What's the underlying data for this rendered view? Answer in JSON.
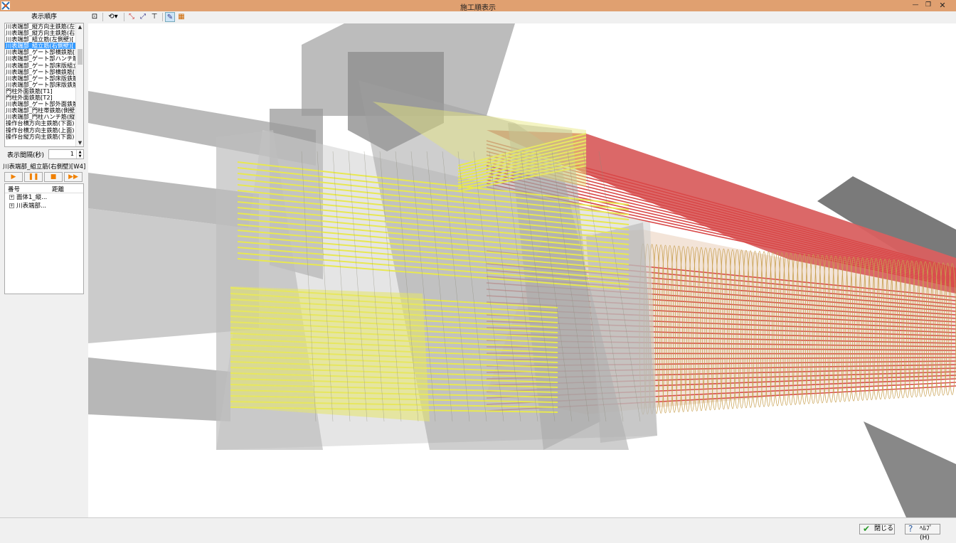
{
  "window": {
    "title": "施工順表示"
  },
  "sequence_panel": {
    "header": "表示順序",
    "items": [
      "川表端部_縦方向主鉄筋(左",
      "川表端部_縦方向主鉄筋(右",
      "川表端部_組立筋(左側壁)[",
      "川表端部_組立筋(右側壁)[",
      "川表端部_ゲート部横鉄筋[",
      "川表端部_ゲート部ハンチ筋",
      "川表端部_ゲート部床版組立",
      "川表端部_ゲート部横鉄筋[",
      "川表端部_ゲート部床版鉄筋",
      "川表端部_ゲート部床版鉄筋",
      "門柱外面鉄筋[T1]",
      "門柱外面鉄筋[T2]",
      "川表端部_ゲート部外面鉄筋",
      "川表端部_門柱帯鉄筋(側壁",
      "川表端部_門柱ハンチ筋(縦",
      "操作台横方向主鉄筋(下面)",
      "操作台横方向主鉄筋(上面)",
      "操作台縦方向主鉄筋(下面)"
    ],
    "selected_index": 3
  },
  "interval": {
    "label": "表示間隔(秒)",
    "value": "1"
  },
  "current_step_label": "川表端部_組立筋(右側壁)[W4]",
  "tree": {
    "col_number": "番号",
    "col_distance": "距離",
    "rows": [
      "面体1_縦...",
      "川表端部..."
    ]
  },
  "buttons": {
    "close": "閉じる",
    "help": "ﾍﾙﾌﾟ(H)"
  },
  "colors": {
    "titlebar": "#e0a070",
    "rebar_red": "#e05050",
    "rebar_yellow": "#e8e850",
    "concrete": "#9a9a9a",
    "selection": "#3399ff"
  },
  "icons": [
    "app-icon",
    "fit-view-icon",
    "rotate-view-icon",
    "axis-x-icon",
    "axis-y-icon",
    "axis-z-icon",
    "perspective-icon",
    "color-display-icon",
    "play-icon",
    "pause-icon",
    "stop-icon",
    "fast-forward-icon",
    "check-icon",
    "help-icon"
  ]
}
